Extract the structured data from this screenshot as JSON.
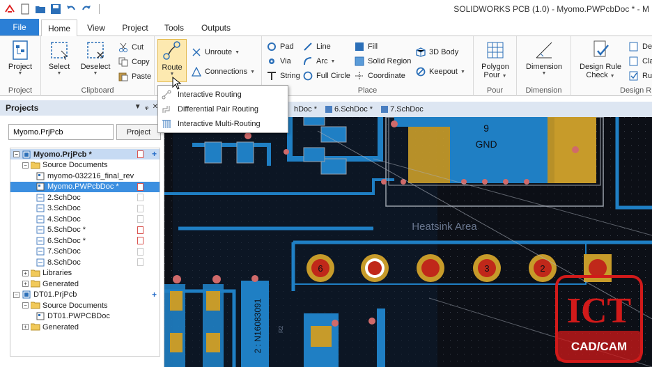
{
  "app_title": "SOLIDWORKS PCB (1.0) - Myomo.PWPcbDoc * - M",
  "file_tab": "File",
  "tabs": [
    "Home",
    "View",
    "Project",
    "Tools",
    "Outputs"
  ],
  "ribbon": {
    "project_group": {
      "label": "Project",
      "btn": "Project"
    },
    "clipboard_group": {
      "label": "Clipboard",
      "select": "Select",
      "deselect": "Deselect",
      "cut": "Cut",
      "copy": "Copy",
      "paste": "Paste"
    },
    "route_group": {
      "route": "Route",
      "unroute": "Unroute",
      "connections": "Connections"
    },
    "place_group": {
      "label": "Place",
      "pad": "Pad",
      "via": "Via",
      "string": "String",
      "line": "Line",
      "arc": "Arc",
      "full_circle": "Full Circle",
      "fill": "Fill",
      "solid_region": "Solid Region",
      "coordinate": "Coordinate",
      "body_3d": "3D Body",
      "keepout": "Keepout"
    },
    "pour_group": {
      "label": "Pour",
      "btn": "Polygon Pour"
    },
    "dimension_group": {
      "label": "Dimension",
      "btn": "Dimension"
    },
    "design_group": {
      "label": "Design R",
      "btn": "Design Rule Check",
      "de": "De",
      "cla": "Cla",
      "ru": "Ru"
    }
  },
  "route_menu": [
    "Interactive Routing",
    "Differential Pair Routing",
    "Interactive Multi-Routing"
  ],
  "projects": {
    "title": "Projects",
    "search_value": "Myomo.PrjPcb",
    "project_button": "Project",
    "tree": [
      {
        "label": "Myomo.PrjPcb *",
        "level": 0,
        "kind": "project",
        "expander": "−",
        "selected": "proj"
      },
      {
        "label": "Source Documents",
        "level": 1,
        "kind": "folder",
        "expander": "−"
      },
      {
        "label": "myomo-032216_final_rev",
        "level": 2,
        "kind": "pcb"
      },
      {
        "label": "Myomo.PWPcbDoc *",
        "level": 2,
        "kind": "pcb",
        "selected": "doc"
      },
      {
        "label": "2.SchDoc",
        "level": 2,
        "kind": "sch"
      },
      {
        "label": "3.SchDoc",
        "level": 2,
        "kind": "sch"
      },
      {
        "label": "4.SchDoc",
        "level": 2,
        "kind": "sch"
      },
      {
        "label": "5.SchDoc *",
        "level": 2,
        "kind": "sch",
        "modified": true
      },
      {
        "label": "6.SchDoc *",
        "level": 2,
        "kind": "sch",
        "modified": true
      },
      {
        "label": "7.SchDoc",
        "level": 2,
        "kind": "sch"
      },
      {
        "label": "8.SchDoc",
        "level": 2,
        "kind": "sch"
      },
      {
        "label": "Libraries",
        "level": 1,
        "kind": "folder",
        "expander": "+"
      },
      {
        "label": "Generated",
        "level": 1,
        "kind": "folder",
        "expander": "+"
      },
      {
        "label": "DT01.PrjPcb",
        "level": 0,
        "kind": "project",
        "expander": "−"
      },
      {
        "label": "Source Documents",
        "level": 1,
        "kind": "folder",
        "expander": "−"
      },
      {
        "label": "DT01.PWPCBDoc",
        "level": 2,
        "kind": "pcb"
      },
      {
        "label": "Generated",
        "level": 1,
        "kind": "folder",
        "expander": "+"
      }
    ]
  },
  "doc_tabs": [
    "hDoc *",
    "6.SchDoc *",
    "7.SchDoc"
  ],
  "pcb": {
    "pad_9": "9",
    "gnd": "GND",
    "heatsink": "Heatsink Area",
    "pads": [
      "6",
      "3",
      "2"
    ],
    "component_text": "2 : N16083091",
    "designator": "R2"
  },
  "logo": {
    "line1": "ICT",
    "line2": "CAD/CAM"
  },
  "colors": {
    "accent": "#2b7fd6",
    "board_bg": "#0c0f16",
    "top_copper": "#1f7fc4",
    "pad_yellow": "#c79b2a",
    "pad_red": "#c0281a"
  }
}
